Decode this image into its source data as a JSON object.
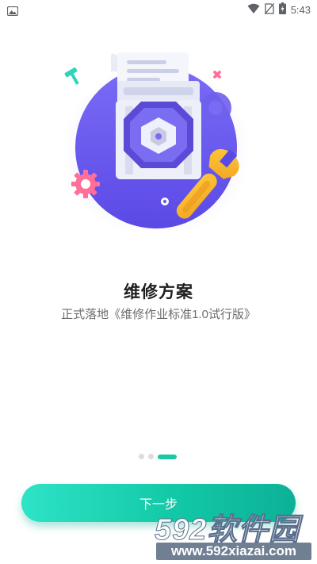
{
  "status_bar": {
    "time": "5:43",
    "icons": [
      "image-icon",
      "wifi-icon",
      "no-sim-icon",
      "battery-charging-icon"
    ]
  },
  "hero": {
    "icon": "maintenance-illustration"
  },
  "page": {
    "title": "维修方案",
    "subtitle": "正式落地《维修作业标准1.0试行版》"
  },
  "pager": {
    "total": 3,
    "current": 3
  },
  "next_button": {
    "label": "下一步"
  },
  "watermark": {
    "brand": "592软件园",
    "url": "www.592xiazai.com"
  },
  "colors": {
    "accent": "#12c9a7",
    "illustration_purple": "#6b5cf0",
    "wrench_yellow": "#f6b92d"
  }
}
